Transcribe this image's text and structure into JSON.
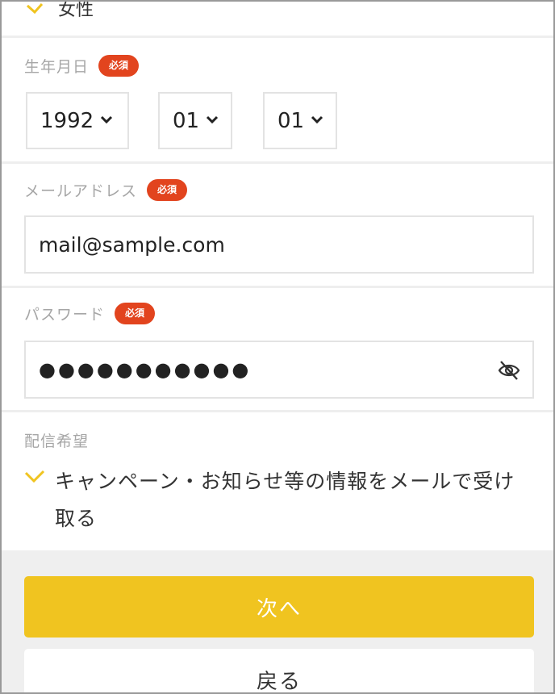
{
  "gender": {
    "option_label": "女性"
  },
  "birthdate": {
    "label": "生年月日",
    "required_badge": "必須",
    "year": "1992",
    "month": "01",
    "day": "01"
  },
  "email": {
    "label": "メールアドレス",
    "required_badge": "必須",
    "value": "mail@sample.com"
  },
  "password": {
    "label": "パスワード",
    "required_badge": "必須",
    "masked_value": "●●●●●●●●●●●"
  },
  "subscription": {
    "label": "配信希望",
    "option_text": "キャンペーン・お知らせ等の情報をメールで受け取る",
    "checked": true
  },
  "actions": {
    "next_label": "次へ",
    "back_label": "戻る"
  },
  "colors": {
    "accent": "#f0c420",
    "badge": "#e2441e",
    "check": "#f0c420"
  }
}
